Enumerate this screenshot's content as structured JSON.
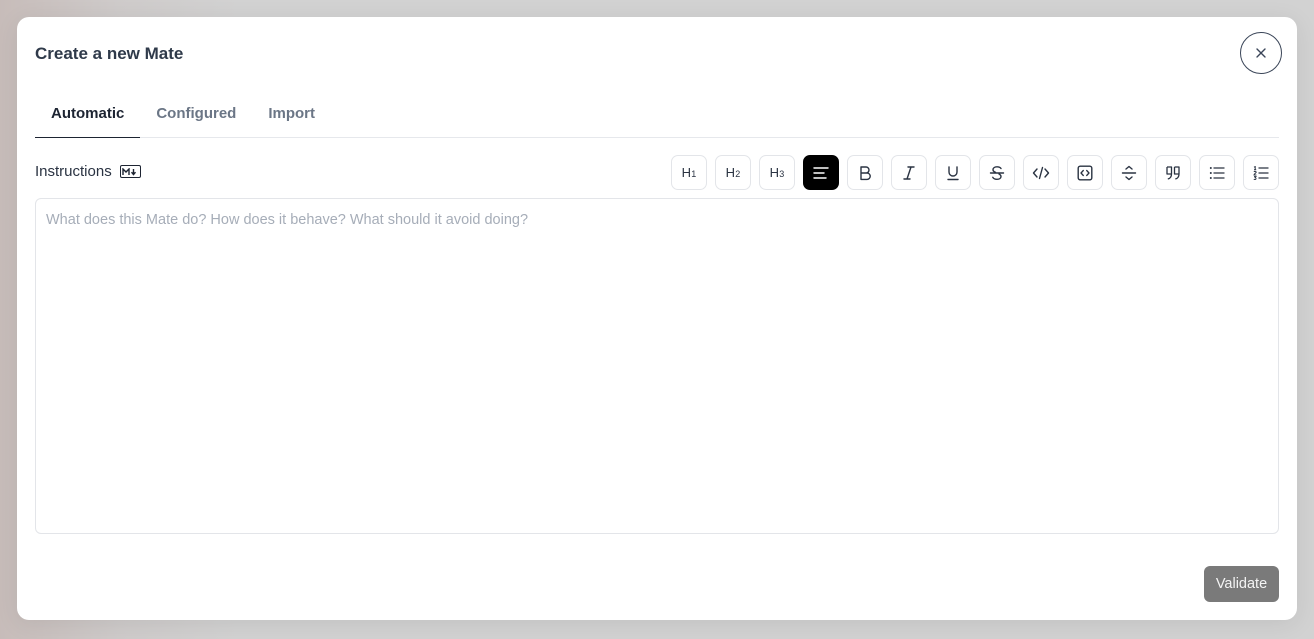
{
  "modal": {
    "title": "Create a new Mate",
    "close_icon": "close-icon"
  },
  "tabs": [
    {
      "label": "Automatic",
      "active": true
    },
    {
      "label": "Configured",
      "active": false
    },
    {
      "label": "Import",
      "active": false
    }
  ],
  "instructions": {
    "label": "Instructions",
    "badge_icon": "markdown-icon"
  },
  "toolbar": {
    "h1": {
      "main": "H",
      "sub": "1"
    },
    "h2": {
      "main": "H",
      "sub": "2"
    },
    "h3": {
      "main": "H",
      "sub": "3"
    },
    "buttons": [
      {
        "icon": "heading-1-icon"
      },
      {
        "icon": "heading-2-icon"
      },
      {
        "icon": "heading-3-icon"
      },
      {
        "icon": "align-left-icon",
        "active": true
      },
      {
        "icon": "bold-icon"
      },
      {
        "icon": "italic-icon"
      },
      {
        "icon": "underline-icon"
      },
      {
        "icon": "strikethrough-icon"
      },
      {
        "icon": "code-icon"
      },
      {
        "icon": "code-block-icon"
      },
      {
        "icon": "horizontal-rule-icon"
      },
      {
        "icon": "quote-icon"
      },
      {
        "icon": "bullet-list-icon"
      },
      {
        "icon": "ordered-list-icon"
      }
    ]
  },
  "editor": {
    "placeholder": "What does this Mate do? How does it behave? What should it avoid doing?",
    "value": ""
  },
  "footer": {
    "validate_label": "Validate"
  },
  "colors": {
    "active_button": "#000000",
    "validate_button": "#7a7a7a",
    "title": "#2f3a4a"
  }
}
